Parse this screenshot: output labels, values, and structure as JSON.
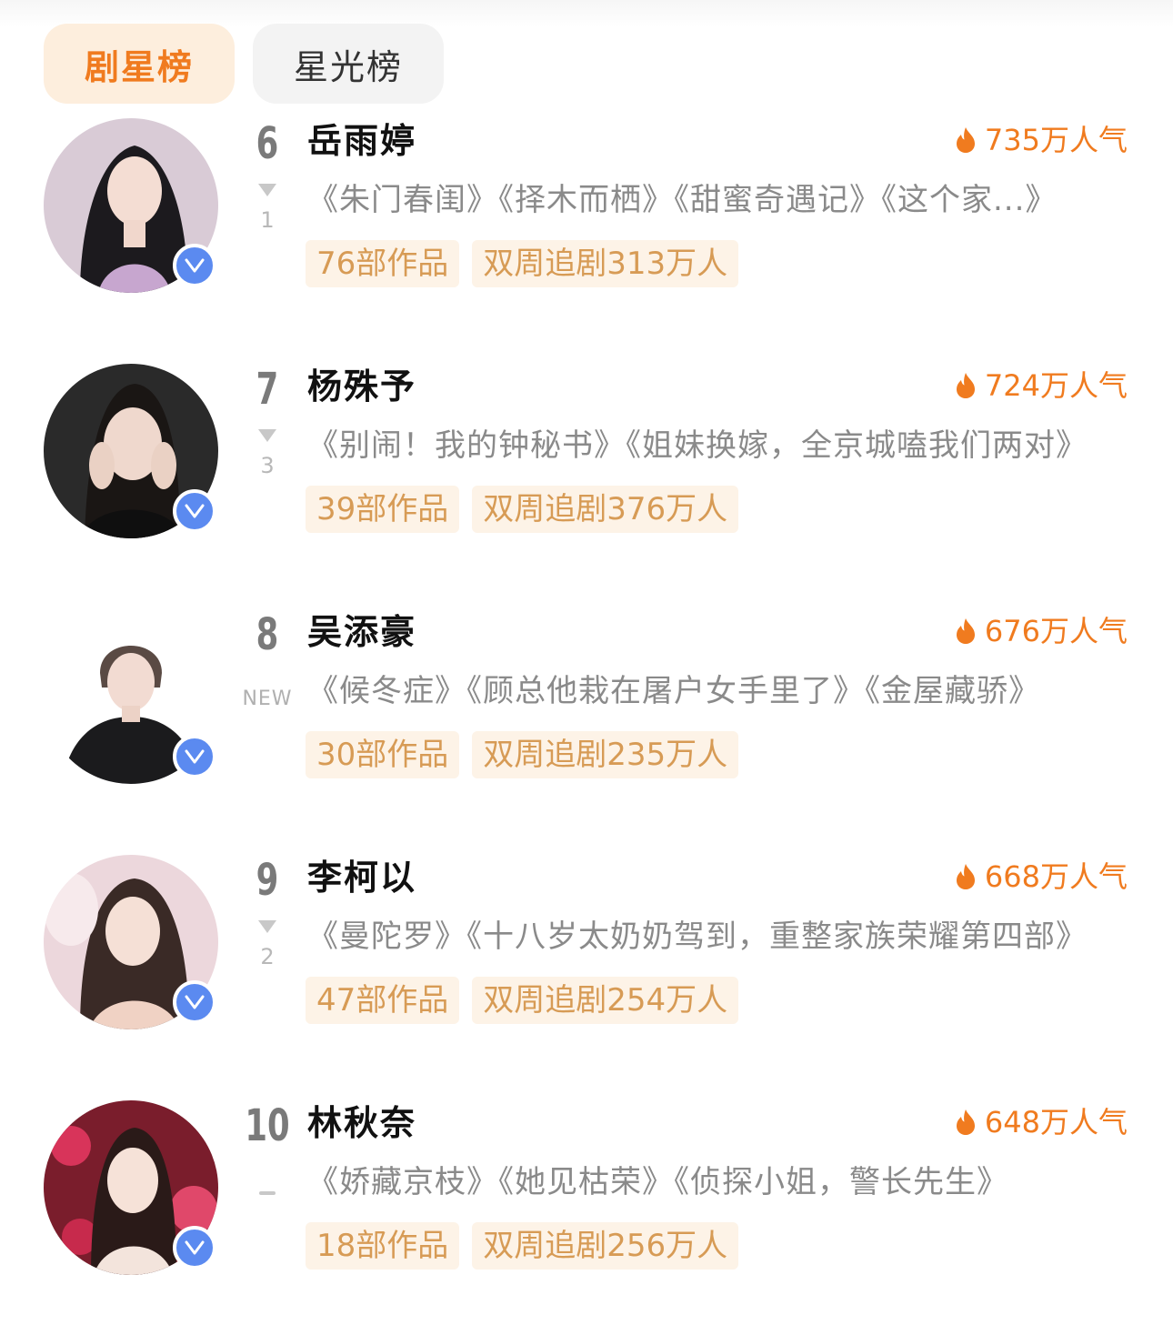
{
  "tabs": [
    {
      "label": "剧星榜",
      "active": true
    },
    {
      "label": "星光榜",
      "active": false
    }
  ],
  "colors": {
    "accent": "#f07b1f",
    "tag_bg": "#fdf3e7",
    "tag_text": "#d79b55",
    "verify": "#5b8af0"
  },
  "entries": [
    {
      "rank": "6",
      "name": "岳雨婷",
      "popularity": "735万人气",
      "trend": {
        "type": "down",
        "value": "1"
      },
      "works": "《朱门春闺》《择木而栖》《甜蜜奇遇记》《这个家...》",
      "works_count": "76部作品",
      "watchers": "双周追剧313万人",
      "avatar_icon": "avatar-photo",
      "verified_icon": "verified-v-icon"
    },
    {
      "rank": "7",
      "name": "杨殊予",
      "popularity": "724万人气",
      "trend": {
        "type": "down",
        "value": "3"
      },
      "works": "《别闹！我的钟秘书》《姐妹换嫁，全京城嗑我们两对》",
      "works_count": "39部作品",
      "watchers": "双周追剧376万人",
      "avatar_icon": "avatar-photo",
      "verified_icon": "verified-v-icon"
    },
    {
      "rank": "8",
      "name": "吴添豪",
      "popularity": "676万人气",
      "trend": {
        "type": "new",
        "value": "NEW"
      },
      "works": "《候冬症》《顾总他栽在屠户女手里了》《金屋藏骄》",
      "works_count": "30部作品",
      "watchers": "双周追剧235万人",
      "avatar_icon": "avatar-photo",
      "verified_icon": "verified-v-icon"
    },
    {
      "rank": "9",
      "name": "李柯以",
      "popularity": "668万人气",
      "trend": {
        "type": "down",
        "value": "2"
      },
      "works": "《曼陀罗》《十八岁太奶奶驾到，重整家族荣耀第四部》",
      "works_count": "47部作品",
      "watchers": "双周追剧254万人",
      "avatar_icon": "avatar-photo",
      "verified_icon": "verified-v-icon"
    },
    {
      "rank": "10",
      "name": "林秋奈",
      "popularity": "648万人气",
      "trend": {
        "type": "same",
        "value": "–"
      },
      "works": "《娇藏京枝》《她见枯荣》《侦探小姐，警长先生》",
      "works_count": "18部作品",
      "watchers": "双周追剧256万人",
      "avatar_icon": "avatar-photo",
      "verified_icon": "verified-v-icon"
    }
  ]
}
